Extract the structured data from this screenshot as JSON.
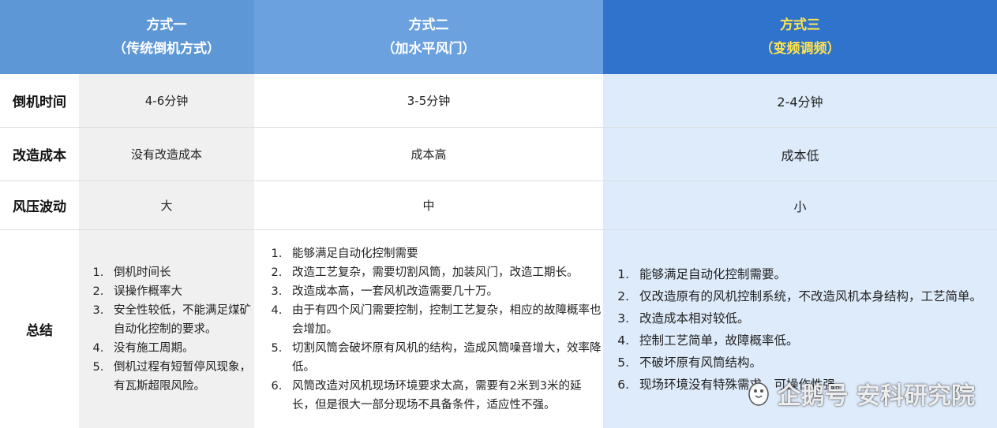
{
  "header": {
    "col1": {
      "line1": "方式一",
      "line2": "（传统倒机方式）"
    },
    "col2": {
      "line1": "方式二",
      "line2": "（加水平风门）"
    },
    "col3": {
      "line1": "方式三",
      "line2": "（变频调频）"
    }
  },
  "rows": {
    "time": {
      "label": "倒机时间",
      "c1": "4-6分钟",
      "c2": "3-5分钟",
      "c3": "2-4分钟"
    },
    "cost": {
      "label": "改造成本",
      "c1": "没有改造成本",
      "c2": "成本高",
      "c3": "成本低"
    },
    "pressure": {
      "label": "风压波动",
      "c1": "大",
      "c2": "中",
      "c3": "小"
    },
    "summary": {
      "label": "总结",
      "c1": [
        "倒机时间长",
        "误操作概率大",
        "安全性较低，不能满足煤矿自动化控制的要求。",
        "没有施工周期。",
        "倒机过程有短暂停风现象，有瓦斯超限风险。"
      ],
      "c2": [
        "能够满足自动化控制需要",
        "改造工艺复杂，需要切割风筒，加装风门，改造工期长。",
        "改造成本高，一套风机改造需要几十万。",
        "由于有四个风门需要控制，控制工艺复杂，相应的故障概率也会增加。",
        "切割风筒会破坏原有风机的结构，造成风筒噪音增大，效率降低。",
        "风筒改造对风机现场环境要求太高，需要有2米到3米的延长，但是很大一部分现场不具备条件，适应性不强。"
      ],
      "c3": [
        "能够满足自动化控制需要。",
        "仅改造原有的风机控制系统，不改造风机本身结构，工艺简单。",
        "改造成本相对较低。",
        "控制工艺简单，故障概率低。",
        "不破坏原有风筒结构。",
        "现场环境没有特殊需求，可操作性强。"
      ]
    }
  },
  "watermark": {
    "text": "企鹅号 安科研究院"
  }
}
